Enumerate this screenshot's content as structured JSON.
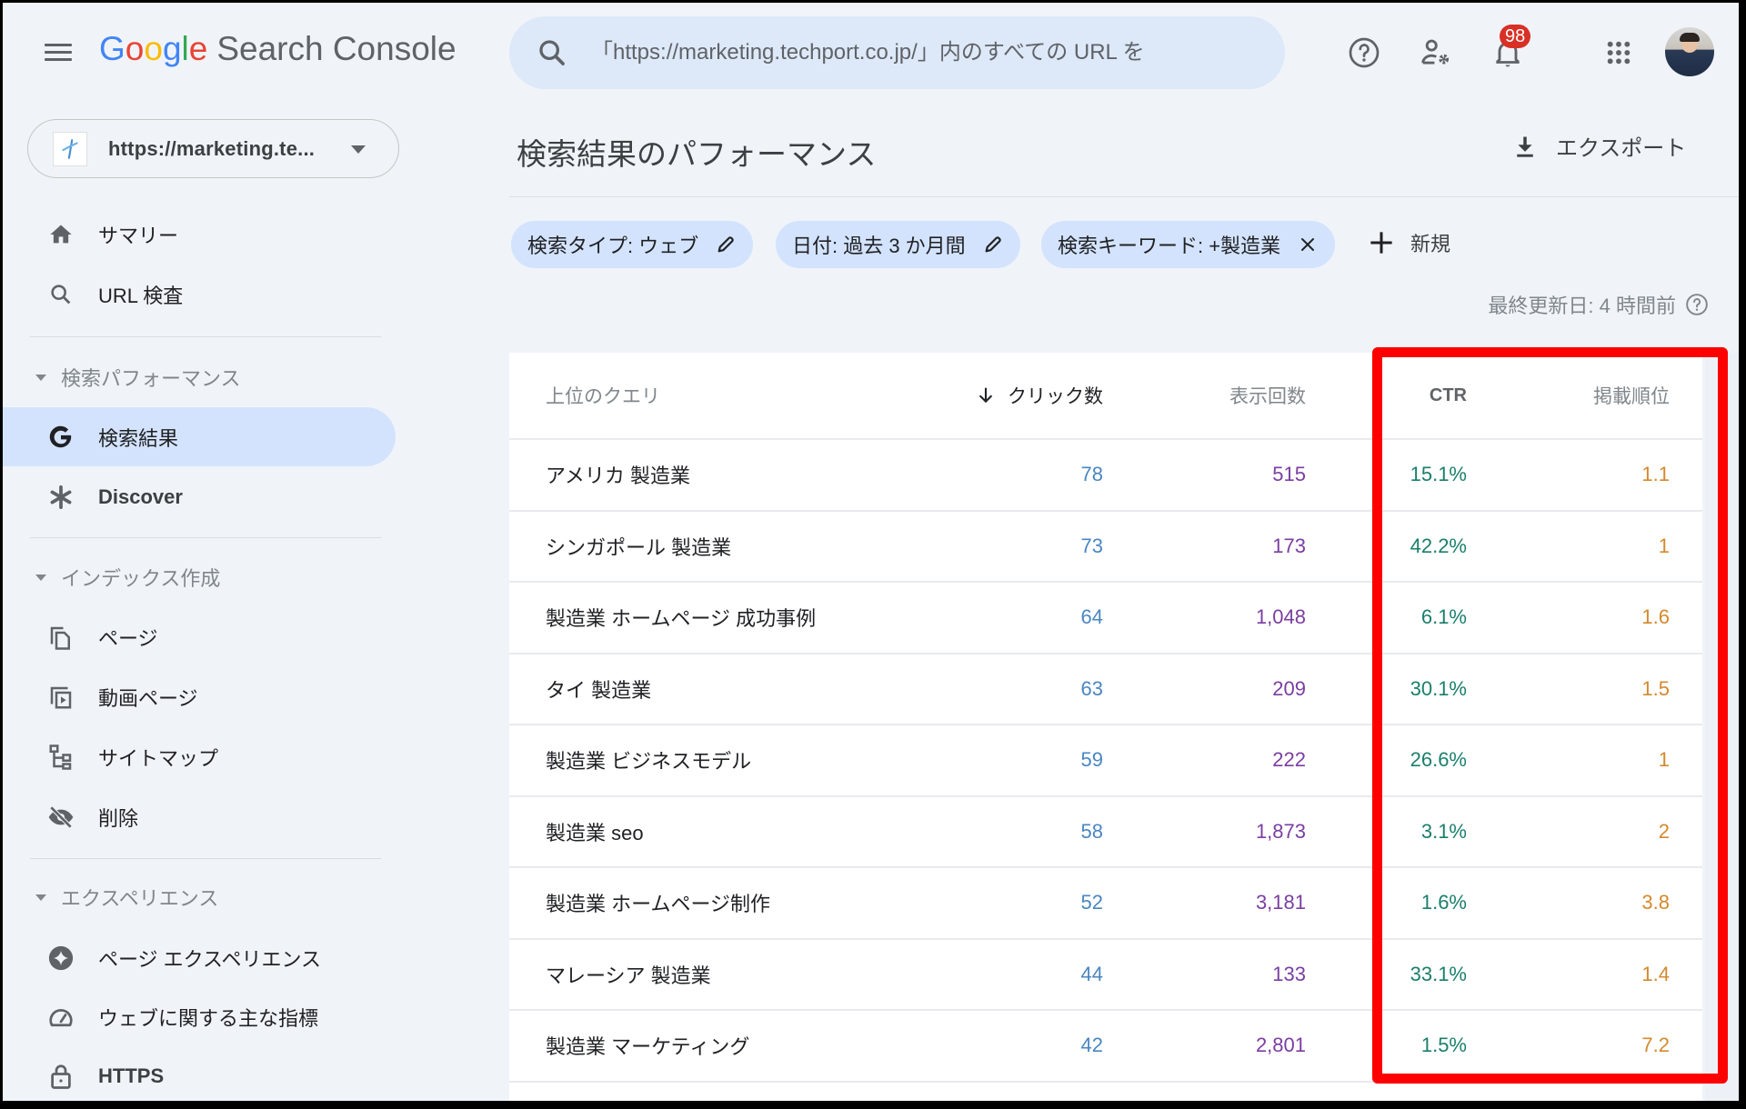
{
  "header": {
    "logo_google": [
      "G",
      "o",
      "o",
      "g",
      "l",
      "e"
    ],
    "product_name": "Search Console",
    "search_placeholder": "「https://marketing.techport.co.jp/」内のすべての URL を",
    "notification_count": "98",
    "icons": [
      "menu-icon",
      "search-icon",
      "help-icon",
      "manage-users-icon",
      "notifications-icon",
      "apps-grid-icon",
      "account-avatar"
    ]
  },
  "sidebar": {
    "property_url": "https://marketing.te...",
    "top_items": [
      {
        "label": "サマリー",
        "icon": "home-icon"
      },
      {
        "label": "URL 検査",
        "icon": "search-icon"
      }
    ],
    "sections": [
      {
        "title": "検索パフォーマンス",
        "items": [
          {
            "label": "検索結果",
            "icon": "google-g-icon",
            "active": true
          },
          {
            "label": "Discover",
            "icon": "asterisk-icon",
            "active": false
          }
        ]
      },
      {
        "title": "インデックス作成",
        "items": [
          {
            "label": "ページ",
            "icon": "pages-icon"
          },
          {
            "label": "動画ページ",
            "icon": "video-pages-icon"
          },
          {
            "label": "サイトマップ",
            "icon": "sitemap-icon"
          },
          {
            "label": "削除",
            "icon": "visibility-off-icon"
          }
        ]
      },
      {
        "title": "エクスペリエンス",
        "items": [
          {
            "label": "ページ エクスペリエンス",
            "icon": "page-experience-icon"
          },
          {
            "label": "ウェブに関する主な指標",
            "icon": "speed-gauge-icon"
          },
          {
            "label": "HTTPS",
            "icon": "lock-icon"
          }
        ]
      }
    ]
  },
  "main": {
    "title": "検索結果のパフォーマンス",
    "export_label": "エクスポート",
    "filters": [
      {
        "label": "検索タイプ: ウェブ",
        "action": "edit"
      },
      {
        "label": "日付: 過去 3 か月間",
        "action": "edit"
      },
      {
        "label": "検索キーワード: +製造業",
        "action": "remove"
      }
    ],
    "new_filter_label": "新規",
    "last_updated": "最終更新日: 4 時間前"
  },
  "table": {
    "columns": {
      "query": "上位のクエリ",
      "clicks": "クリック数",
      "impressions": "表示回数",
      "ctr": "CTR",
      "position": "掲載順位"
    },
    "sorted_by": "clicks",
    "sort_direction": "descending",
    "rows": [
      {
        "query": "アメリカ 製造業",
        "clicks": "78",
        "impressions": "515",
        "ctr": "15.1%",
        "position": "1.1"
      },
      {
        "query": "シンガポール 製造業",
        "clicks": "73",
        "impressions": "173",
        "ctr": "42.2%",
        "position": "1"
      },
      {
        "query": "製造業 ホームページ 成功事例",
        "clicks": "64",
        "impressions": "1,048",
        "ctr": "6.1%",
        "position": "1.6"
      },
      {
        "query": "タイ 製造業",
        "clicks": "63",
        "impressions": "209",
        "ctr": "30.1%",
        "position": "1.5"
      },
      {
        "query": "製造業 ビジネスモデル",
        "clicks": "59",
        "impressions": "222",
        "ctr": "26.6%",
        "position": "1"
      },
      {
        "query": "製造業 seo",
        "clicks": "58",
        "impressions": "1,873",
        "ctr": "3.1%",
        "position": "2"
      },
      {
        "query": "製造業 ホームページ制作",
        "clicks": "52",
        "impressions": "3,181",
        "ctr": "1.6%",
        "position": "3.8"
      },
      {
        "query": "マレーシア 製造業",
        "clicks": "44",
        "impressions": "133",
        "ctr": "33.1%",
        "position": "1.4"
      },
      {
        "query": "製造業 マーケティング",
        "clicks": "42",
        "impressions": "2,801",
        "ctr": "1.5%",
        "position": "7.2"
      }
    ]
  },
  "colors": {
    "clicks": "#4a86c1",
    "impressions": "#7b3ea1",
    "ctr": "#1a7f6b",
    "position": "#d4892e",
    "active_nav": "#d3e3fd",
    "annotation_box": "#ff0000"
  },
  "annotation": {
    "highlighted_columns": [
      "ctr",
      "position"
    ]
  }
}
